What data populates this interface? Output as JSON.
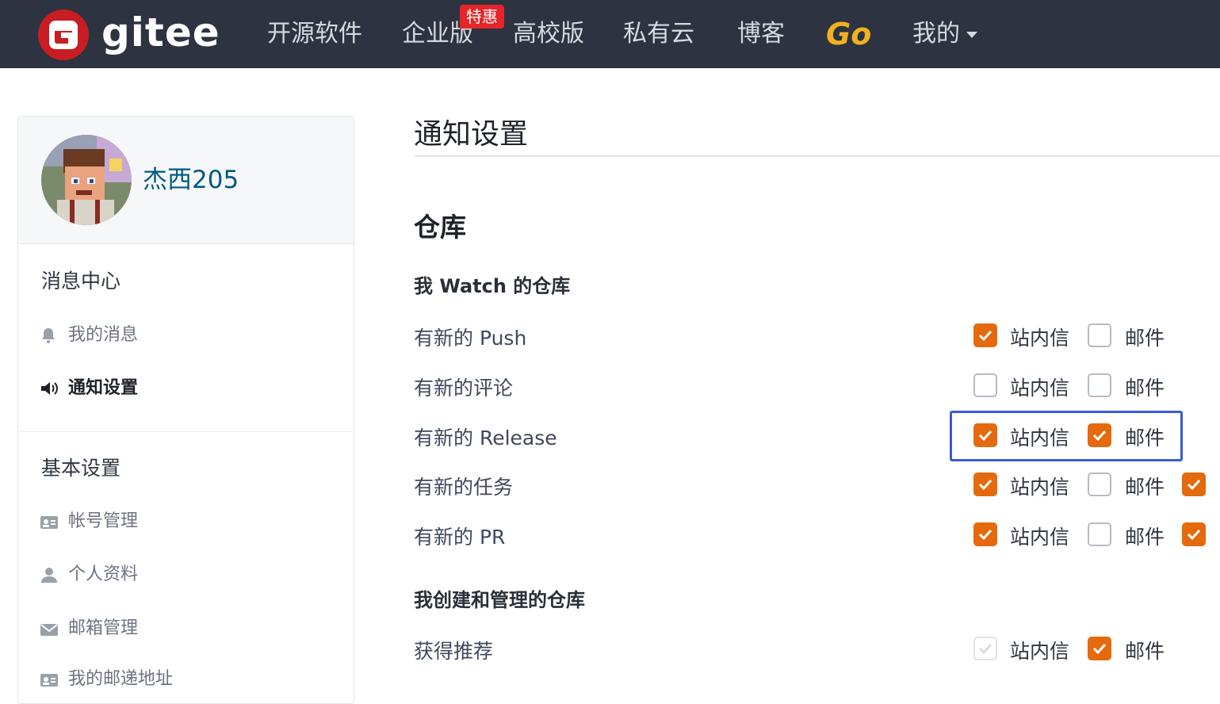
{
  "header": {
    "logo_text": "gitee",
    "nav": [
      {
        "label": "开源软件"
      },
      {
        "label": "企业版"
      },
      {
        "label": "高校版"
      },
      {
        "label": "私有云"
      },
      {
        "label": "博客"
      }
    ],
    "badge": "特惠",
    "go_label": "Go",
    "mine_label": "我的"
  },
  "sidebar": {
    "username": "杰西205",
    "section1": "消息中心",
    "items1": [
      {
        "label": "我的消息",
        "icon": "bell-icon"
      },
      {
        "label": "通知设置",
        "icon": "speaker-icon",
        "active": true
      }
    ],
    "section2": "基本设置",
    "items2": [
      {
        "label": "帐号管理",
        "icon": "id-card-icon"
      },
      {
        "label": "个人资料",
        "icon": "user-icon"
      },
      {
        "label": "邮箱管理",
        "icon": "envelope-icon"
      },
      {
        "label": "我的邮递地址",
        "icon": "address-card-icon"
      }
    ]
  },
  "main": {
    "title": "通知设置",
    "section": "仓库",
    "group1": {
      "title": "我 Watch 的仓库",
      "rows": [
        {
          "label": "有新的 Push",
          "site": true,
          "mail": false
        },
        {
          "label": "有新的评论",
          "site": false,
          "mail": false
        },
        {
          "label": "有新的 Release",
          "site": true,
          "mail": true
        },
        {
          "label": "有新的任务",
          "site": true,
          "mail": false,
          "extra": true
        },
        {
          "label": "有新的 PR",
          "site": true,
          "mail": false,
          "extra": true
        }
      ]
    },
    "group2": {
      "title": "我创建和管理的仓库",
      "rows": [
        {
          "label": "获得推荐",
          "site": "disabled-checked",
          "mail": true
        }
      ]
    },
    "site_label": "站内信",
    "mail_label": "邮件",
    "accent": "#e56a0d",
    "highlight_color": "#3a5bd9"
  }
}
